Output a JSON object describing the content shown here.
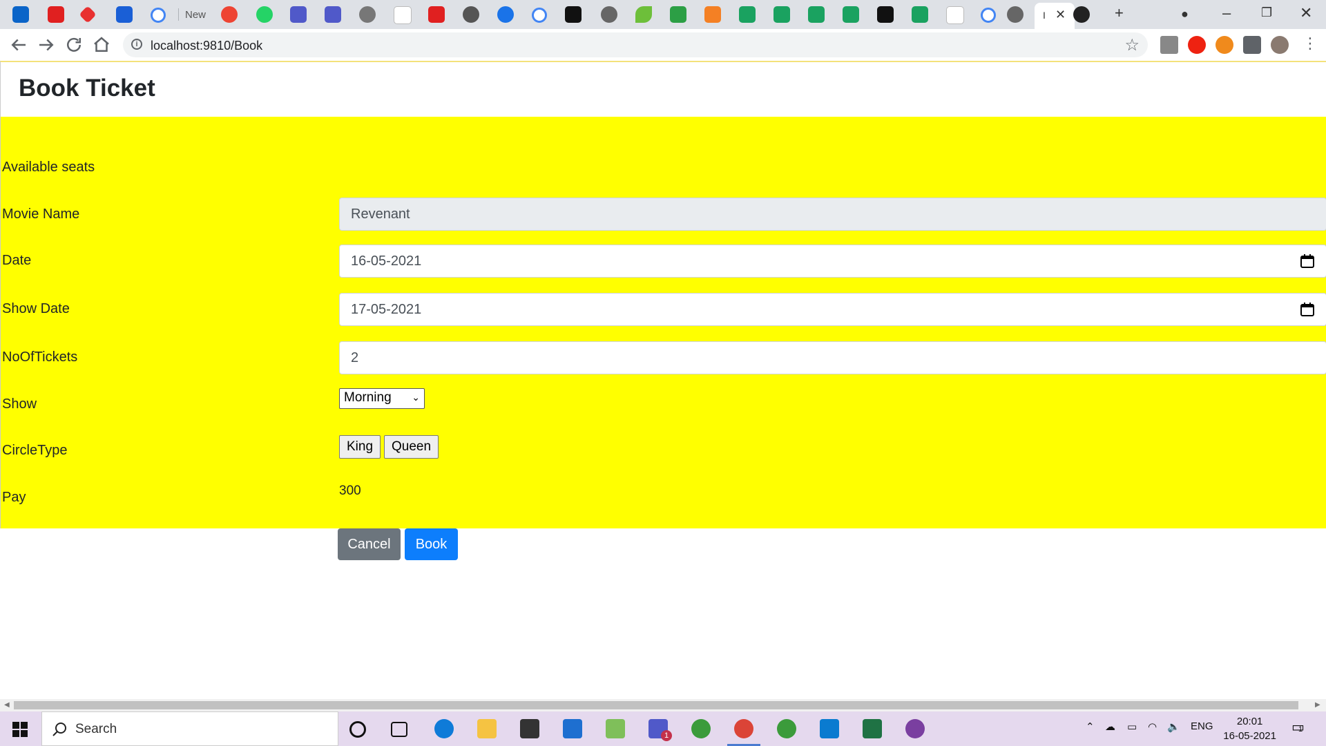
{
  "browser": {
    "tab_new_label": "New",
    "active_tab_label": "I",
    "url": "localhost:9810/Book",
    "tab_icons": [
      "outlook-icon",
      "youtube-icon",
      "vivaldi-icon",
      "jira-icon",
      "google-icon",
      "new-tab-icon",
      "alert-icon",
      "whatsapp-icon",
      "teams-icon",
      "teams-icon",
      "globe-icon",
      "w3schools-icon",
      "youtube-icon",
      "globe-icon",
      "settings-icon",
      "google-icon",
      "fn-icon",
      "globe-icon",
      "leaf-icon",
      "link-icon",
      "stack-icon",
      "w-icon",
      "w-icon",
      "w-icon",
      "w-icon",
      "notion-icon",
      "w-icon",
      "pro-icon",
      "google-icon",
      "globe-icon"
    ]
  },
  "page": {
    "title": "Book Ticket",
    "labels": {
      "available_seats": "Available seats",
      "movie_name": "Movie Name",
      "date": "Date",
      "show_date": "Show Date",
      "no_of_tickets": "NoOfTickets",
      "show": "Show",
      "circle_type": "CircleType",
      "pay": "Pay"
    },
    "values": {
      "movie_name": "Revenant",
      "date": "16-05-2021",
      "show_date": "17-05-2021",
      "no_of_tickets": "2",
      "show": "Morning",
      "pay": "300"
    },
    "circle_buttons": [
      "King",
      "Queen"
    ],
    "actions": {
      "cancel": "Cancel",
      "book": "Book"
    },
    "colors": {
      "form_bg": "#ffff00",
      "cancel_bg": "#6c757d",
      "book_bg": "#0d7efc"
    }
  },
  "taskbar": {
    "search_placeholder": "Search",
    "language": "ENG",
    "time": "20:01",
    "date": "16-05-2021",
    "notification_count": "1",
    "teams_badge": "1"
  }
}
